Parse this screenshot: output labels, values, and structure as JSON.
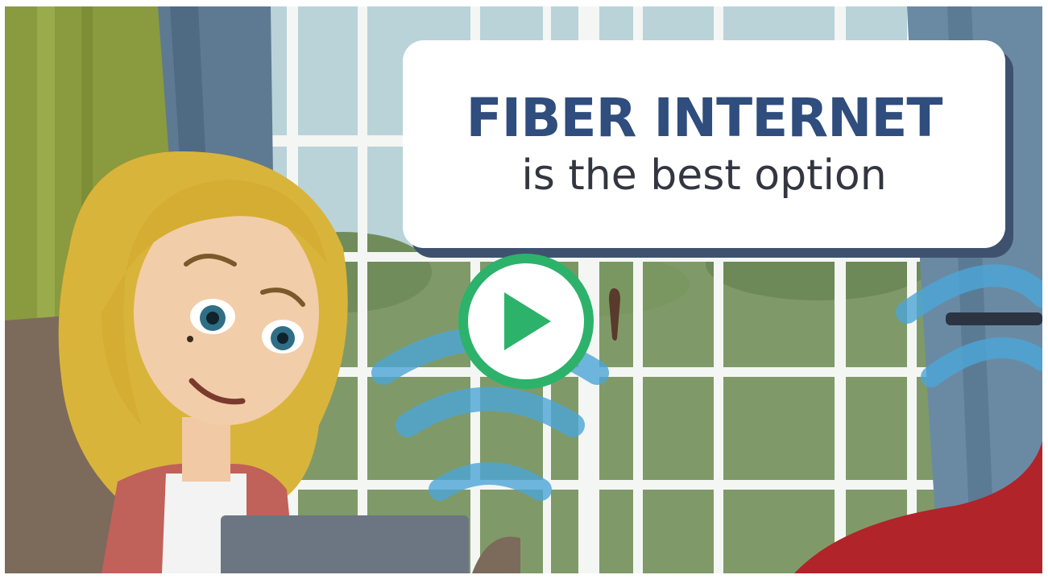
{
  "video": {
    "caption_title": "FIBER INTERNET",
    "caption_subtitle": "is the best option",
    "play_icon": "play-icon",
    "play_color": "#2db26b",
    "title_color": "#2f4d7d"
  }
}
